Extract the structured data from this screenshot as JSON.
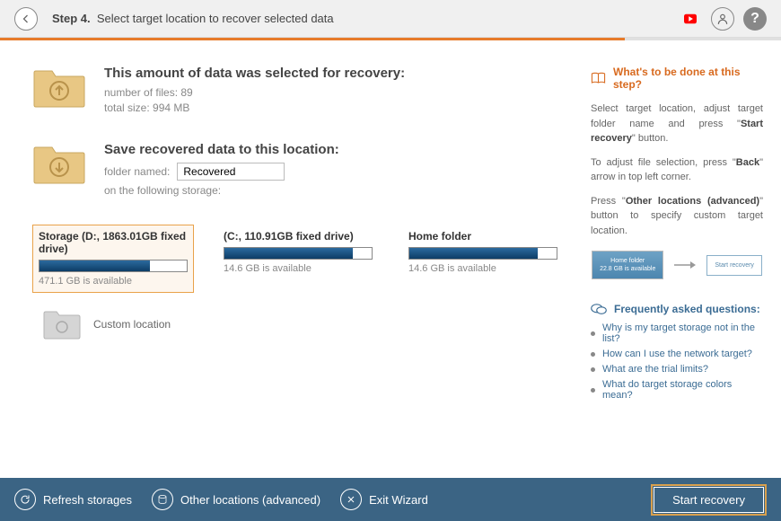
{
  "header": {
    "step_label": "Step 4.",
    "title": "Select target location to recover selected data"
  },
  "summary": {
    "heading": "This amount of data was selected for recovery:",
    "files_label": "number of files: 89",
    "size_label": "total size: 994 MB"
  },
  "save": {
    "heading": "Save recovered data to this location:",
    "folder_label": "folder named:",
    "folder_value": "Recovered",
    "storage_label": "on the following storage:"
  },
  "storages": [
    {
      "label": "Storage (D:, 1863.01GB fixed drive)",
      "avail": "471.1 GB is available",
      "fill": 75,
      "selected": true
    },
    {
      "label": "(C:, 110.91GB fixed drive)",
      "avail": "14.6 GB is available",
      "fill": 87,
      "selected": false
    },
    {
      "label": "Home folder",
      "avail": "14.6 GB is available",
      "fill": 87,
      "selected": false
    }
  ],
  "custom_label": "Custom location",
  "side": {
    "head": "What's to be done at this step?",
    "p1a": "Select target location, adjust target folder name and press \"",
    "p1b": "Start recovery",
    "p1c": "\" button.",
    "p2a": "To adjust file selection, press \"",
    "p2b": "Back",
    "p2c": "\" arrow in top left corner.",
    "p3a": "Press \"",
    "p3b": "Other locations (advanced)",
    "p3c": "\" button to specify custom target location.",
    "hint1a": "Home folder",
    "hint1b": "22.8 GB is available",
    "hint2": "Start recovery"
  },
  "faq": {
    "head": "Frequently asked questions:",
    "items": [
      "Why is my target storage not in the list?",
      "How can I use the network target?",
      "What are the trial limits?",
      "What do target storage colors mean?"
    ]
  },
  "footer": {
    "refresh": "Refresh storages",
    "other": "Other locations (advanced)",
    "exit": "Exit Wizard",
    "start": "Start recovery"
  }
}
